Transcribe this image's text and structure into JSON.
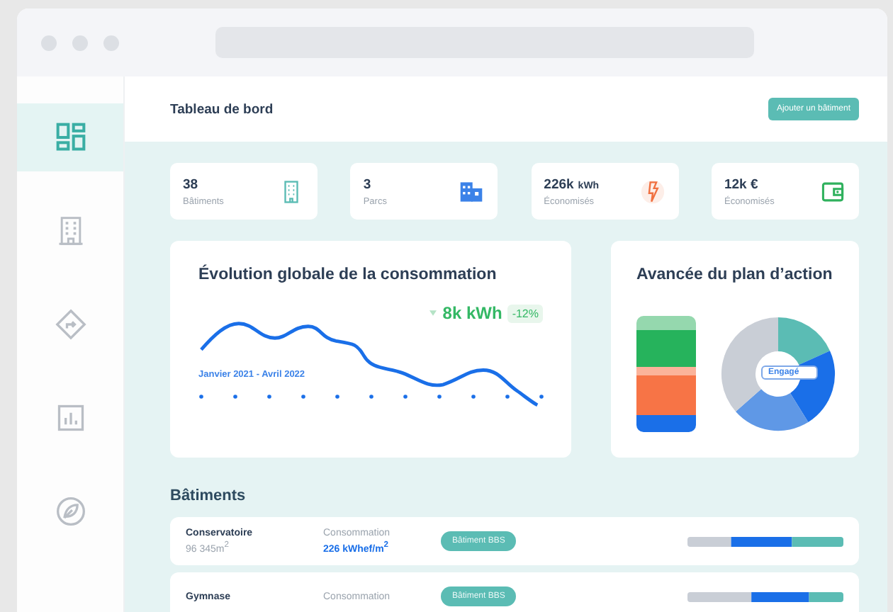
{
  "sidebar": {
    "items": [
      {
        "selected": true
      },
      {
        "selected": false
      },
      {
        "selected": false
      },
      {
        "selected": false
      },
      {
        "selected": false
      }
    ]
  },
  "header": {
    "title": "Tableau de bord",
    "button": "Ajouter un bâtiment"
  },
  "stats": [
    {
      "value": "38",
      "label": "Bâtiments"
    },
    {
      "value": "3",
      "label": "Parcs"
    },
    {
      "value": "226k",
      "unit": "kWh",
      "label": "Économisés"
    },
    {
      "value": "12k €",
      "label": "Économisés"
    }
  ],
  "consumption": {
    "title": "Évolution globale de la consommation",
    "value": "8k kWh",
    "change": "-12%",
    "period": "Janvier 2021 - Avril 2022"
  },
  "action_plan": {
    "title": "Avancée du plan d’action",
    "tooltip": "Engagé"
  },
  "buildings": {
    "title": "Bâtiments",
    "rows": [
      {
        "name": "Conservatoire",
        "area": "96 345m$^{2}$",
        "metric_label": "Consommation",
        "metric_value": "226 kWhef/m$^{2}$",
        "tag": "Bâtiment BBS"
      },
      {
        "name": "Gymnase",
        "metric_label": "Consommation",
        "tag": "Bâtiment BBS"
      }
    ]
  }
}
